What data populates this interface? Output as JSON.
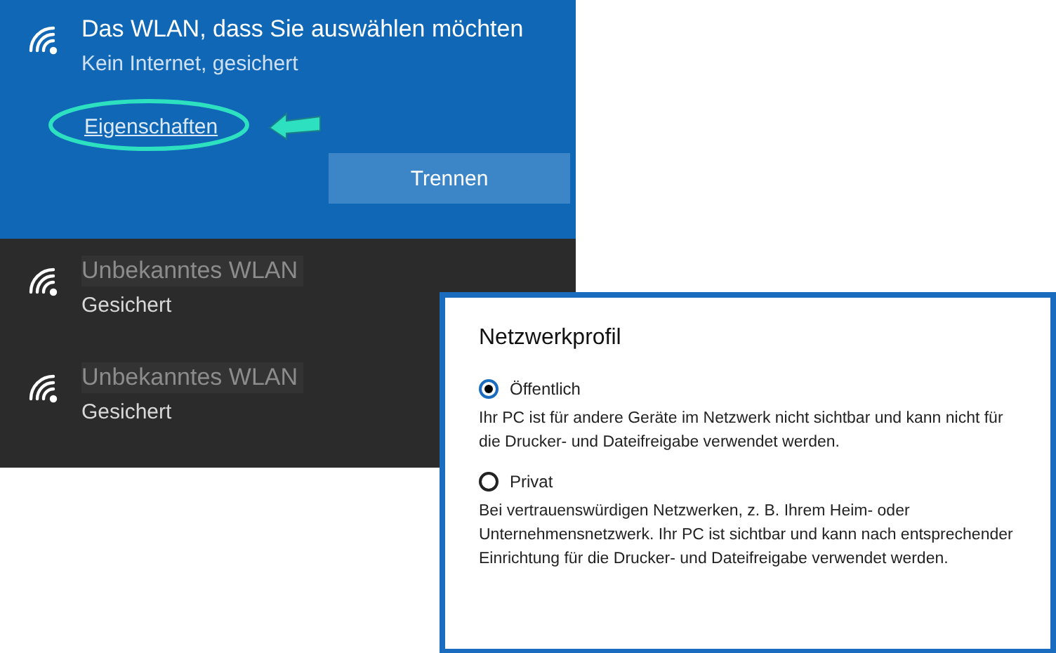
{
  "current_network": {
    "name": "Das WLAN, dass Sie auswählen möchten",
    "status": "Kein Internet, gesichert",
    "link": "Eigenschaften",
    "button": "Trennen"
  },
  "other_networks": [
    {
      "name": "Unbekanntes WLAN",
      "status": "Gesichert"
    },
    {
      "name": "Unbekanntes WLAN",
      "status": "Gesichert"
    }
  ],
  "dialog": {
    "title": "Netzwerkprofil",
    "options": [
      {
        "label": "Öffentlich",
        "selected": true,
        "description": "Ihr PC ist für andere Geräte im Netzwerk nicht sichtbar und kann nicht für die Drucker- und Dateifreigabe verwendet werden."
      },
      {
        "label": "Privat",
        "selected": false,
        "description": "Bei vertrauenswürdigen Netzwerken, z. B. Ihrem Heim- oder Unternehmensnetzwerk. Ihr PC ist sichtbar und kann nach entsprechender Einrichtung für die Drucker- und Dateifreigabe verwendet werden."
      }
    ]
  }
}
